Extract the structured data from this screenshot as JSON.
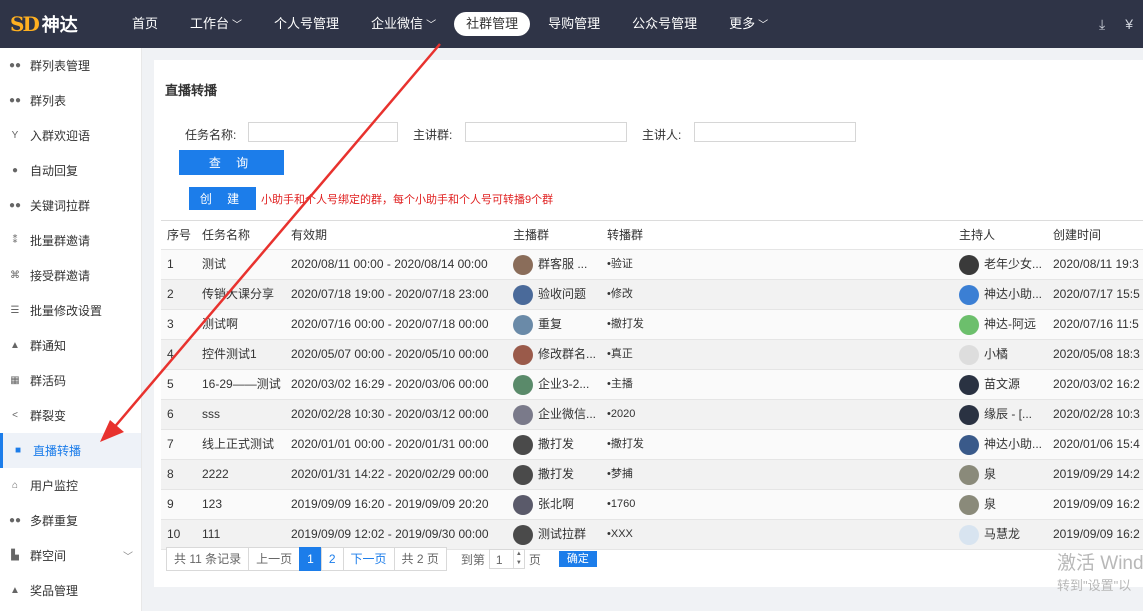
{
  "brand": {
    "mark": "SD",
    "name": "神达"
  },
  "nav": [
    {
      "label": "首页",
      "caret": false
    },
    {
      "label": "工作台",
      "caret": true
    },
    {
      "label": "个人号管理",
      "caret": false
    },
    {
      "label": "企业微信",
      "caret": true
    },
    {
      "label": "社群管理",
      "caret": false,
      "active": true
    },
    {
      "label": "导购管理",
      "caret": false
    },
    {
      "label": "公众号管理",
      "caret": false
    },
    {
      "label": "更多",
      "caret": true
    }
  ],
  "top_icons": [
    "download-icon",
    "currency-icon"
  ],
  "sidebar": [
    {
      "label": "群列表管理",
      "icon": "group-icon"
    },
    {
      "label": "群列表",
      "icon": "group-icon"
    },
    {
      "label": "入群欢迎语",
      "icon": "cheers-icon"
    },
    {
      "label": "自动回复",
      "icon": "chat-icon"
    },
    {
      "label": "关键词拉群",
      "icon": "group-icon"
    },
    {
      "label": "批量群邀请",
      "icon": "invite-icon"
    },
    {
      "label": "接受群邀请",
      "icon": "accept-icon"
    },
    {
      "label": "批量修改设置",
      "icon": "sliders-icon"
    },
    {
      "label": "群通知",
      "icon": "bell-icon"
    },
    {
      "label": "群活码",
      "icon": "qrcode-icon"
    },
    {
      "label": "群裂变",
      "icon": "share-icon"
    },
    {
      "label": "直播转播",
      "icon": "video-icon",
      "active": true
    },
    {
      "label": "用户监控",
      "icon": "home-icon"
    },
    {
      "label": "多群重复",
      "icon": "group-icon"
    },
    {
      "label": "群空间",
      "icon": "space-icon",
      "expand": true
    },
    {
      "label": "奖品管理",
      "icon": "thumb-icon"
    }
  ],
  "panel_title": "直播转播",
  "filters": {
    "task_name_label": "任务名称:",
    "host_group_label": "主讲群:",
    "speaker_label": "主讲人:"
  },
  "query_label": "查 询",
  "create_label": "创 建",
  "tip": "小助手和个人号绑定的群，每个小助手和个人号可转播9个群",
  "table": {
    "headers": [
      "序号",
      "任务名称",
      "有效期",
      "主播群",
      "转播群",
      "主持人",
      "创建时间"
    ],
    "rows": [
      {
        "no": "1",
        "name": "测试",
        "period": "2020/08/11 00:00 - 2020/08/14 00:00",
        "host_group": "群客服 ...",
        "relay": "•验证",
        "host": "老年少女...",
        "created": "2020/08/11 19:3",
        "hg_color": "#8a6d5a",
        "h_color": "#3a3a3a"
      },
      {
        "no": "2",
        "name": "传销大课分享",
        "period": "2020/07/18 19:00 - 2020/07/18 23:00",
        "host_group": "验收问题",
        "relay": "•修改",
        "host": "神达小助...",
        "created": "2020/07/17 15:5",
        "hg_color": "#4a6a9a",
        "h_color": "#3b7fd4"
      },
      {
        "no": "3",
        "name": "测试啊",
        "period": "2020/07/16 00:00 - 2020/07/18 00:00",
        "host_group": "重复",
        "relay": "•撤打发",
        "host": "神达-阿远",
        "created": "2020/07/16 11:5",
        "hg_color": "#6a8aa8",
        "h_color": "#6cbf6c"
      },
      {
        "no": "4",
        "name": "控件测试1",
        "period": "2020/05/07 00:00 - 2020/05/10 00:00",
        "host_group": "修改群名...",
        "relay": "•真正",
        "host": "小橘",
        "created": "2020/05/08 18:3",
        "hg_color": "#9a5a4a",
        "h_color": "#dddddd"
      },
      {
        "no": "5",
        "name": "16-29——测试",
        "period": "2020/03/02 16:29 - 2020/03/06 00:00",
        "host_group": "企业3-2...",
        "relay": "•主播",
        "host": "苗文源",
        "created": "2020/03/02 16:2",
        "hg_color": "#5a8a6a",
        "h_color": "#2a3242"
      },
      {
        "no": "6",
        "name": "sss",
        "period": "2020/02/28 10:30 - 2020/03/12 00:00",
        "host_group": "企业微信...",
        "relay": "•2020",
        "host": "缘辰 - [...",
        "created": "2020/02/28 10:3",
        "hg_color": "#7a7a8a",
        "h_color": "#2a3242"
      },
      {
        "no": "7",
        "name": "线上正式测试",
        "period": "2020/01/01 00:00 - 2020/01/31 00:00",
        "host_group": "撒打发",
        "relay": "•撒打发",
        "host": "神达小助...",
        "created": "2020/01/06 15:4",
        "hg_color": "#4a4a4a",
        "h_color": "#3a5a8a"
      },
      {
        "no": "8",
        "name": "2222",
        "period": "2020/01/31 14:22 - 2020/02/29 00:00",
        "host_group": "撒打发",
        "relay": "•梦捕",
        "host": "泉",
        "created": "2019/09/29 14:2",
        "hg_color": "#4a4a4a",
        "h_color": "#8a8a7a"
      },
      {
        "no": "9",
        "name": "123",
        "period": "2019/09/09 16:20 - 2019/09/09 20:20",
        "host_group": "张北啊",
        "relay": "•1760",
        "host": "泉",
        "created": "2019/09/09 16:2",
        "hg_color": "#5a5a6a",
        "h_color": "#8a8a7a"
      },
      {
        "no": "10",
        "name": "111",
        "period": "2019/09/09 12:02 - 2019/09/30 00:00",
        "host_group": "测试拉群",
        "relay": "•XXX",
        "host": "马慧龙",
        "created": "2019/09/09 16:2",
        "hg_color": "#4a4a4a",
        "h_color": "#d8e4f0"
      }
    ]
  },
  "pager": {
    "total": "共 11 条记录",
    "prev": "上一页",
    "pages": [
      "1",
      "2"
    ],
    "next": "下一页",
    "page_count": "共 2 页",
    "jump_label": "到第",
    "jump_value": "1",
    "page_unit": "页",
    "ok": "确定"
  },
  "watermark": {
    "line1": "激活 Wind",
    "line2": "转到\"设置\"以"
  },
  "accent": "#1c7dea",
  "arrow_color": "#e8322e"
}
